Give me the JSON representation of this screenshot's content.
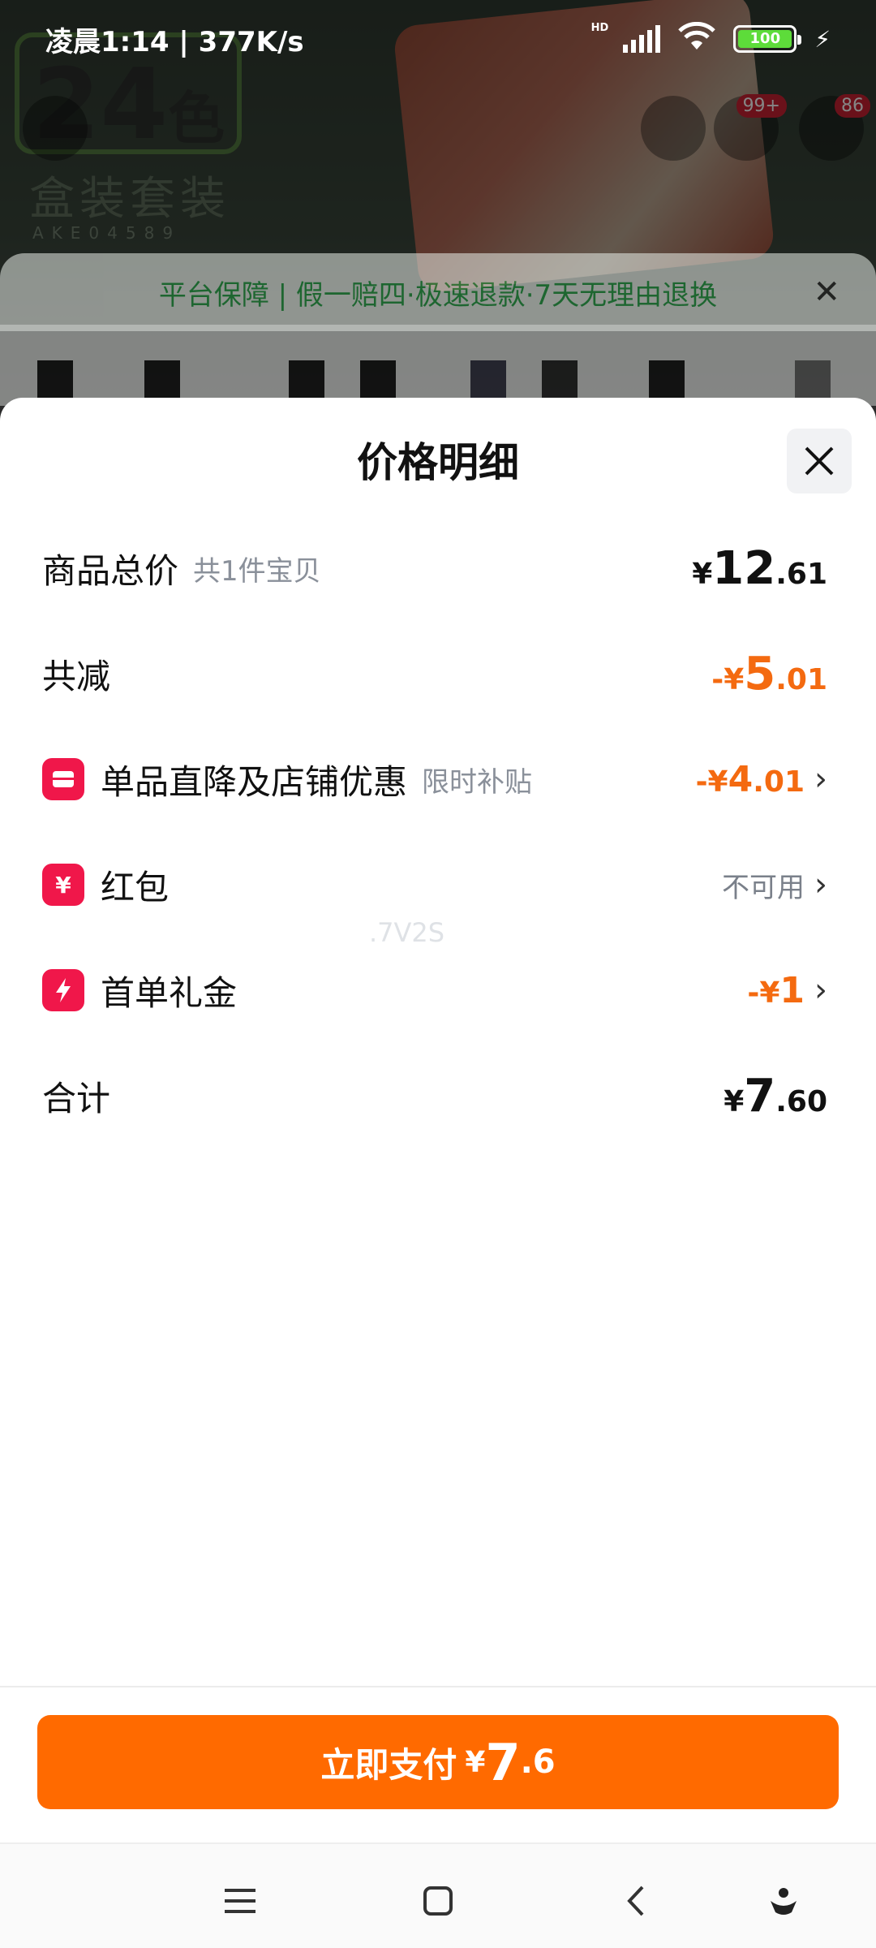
{
  "status_bar": {
    "time_speed": "凌晨1:14 | 377K/s",
    "hd": "HD",
    "battery": "100"
  },
  "background": {
    "big_number": "24",
    "big_char": "色",
    "box_text": "盒装套装",
    "product_code": "AKE04589",
    "cart_badge": "99+",
    "msg_badge": "86"
  },
  "guarantee": {
    "text": "平台保障 | 假一赔四·极速退款·7天无理由退换"
  },
  "sheet": {
    "title": "价格明细",
    "rows": [
      {
        "label": "商品总价",
        "sub": "共1件宝贝",
        "yen": "¥",
        "int": "12",
        "dec": ".61"
      },
      {
        "label": "共减",
        "yen": "-¥",
        "int": "5",
        "dec": ".01"
      },
      {
        "label": "单品直降及店铺优惠",
        "sub": "限时补贴",
        "icon": "store-icon",
        "yen": "-¥",
        "int": "4",
        "dec": ".01"
      },
      {
        "label": "红包",
        "icon": "red-packet-icon",
        "status": "不可用"
      },
      {
        "label": "首单礼金",
        "icon": "gift-bolt-icon",
        "yen": "-¥",
        "int": "1"
      },
      {
        "label": "合计",
        "yen": "¥",
        "int": "7",
        "dec": ".60"
      }
    ],
    "watermark": ".7V2S"
  },
  "pay_button": {
    "label": "立即支付",
    "yen": "¥",
    "int": "7",
    "dec": ".6"
  },
  "colors": {
    "accent": "#ff6a00",
    "discount": "#f46a10",
    "icon_red": "#f0174a"
  },
  "nav_icons": [
    "menu-icon",
    "home-icon",
    "back-icon",
    "assistant-icon"
  ]
}
